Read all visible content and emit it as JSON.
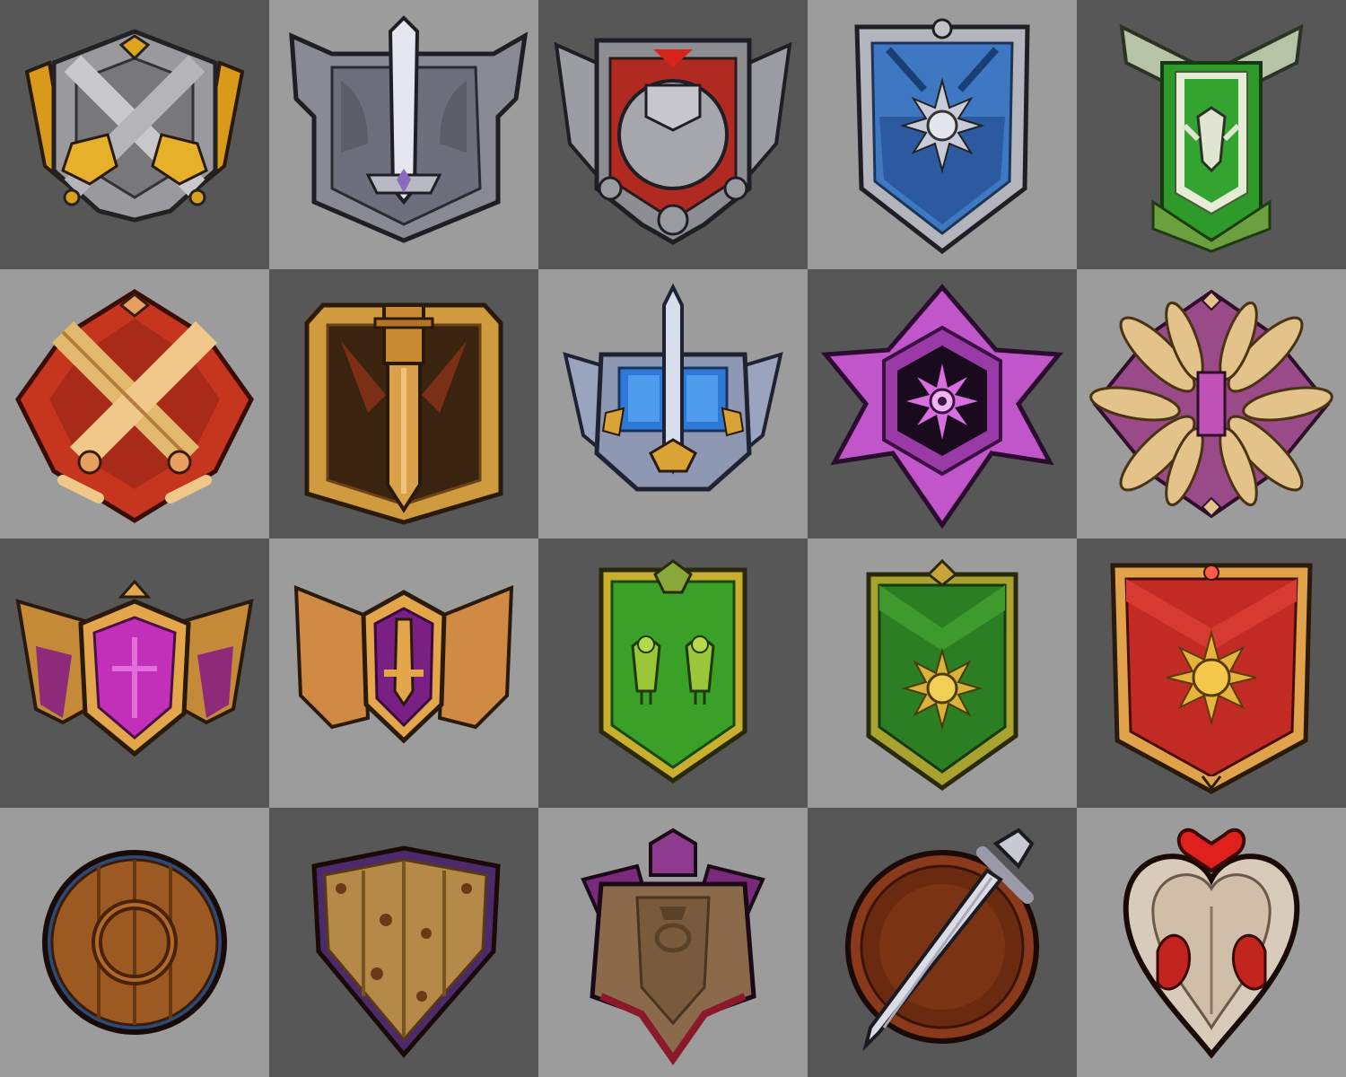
{
  "sheet": {
    "colors": {
      "dark_cell": "#575757",
      "light_cell": "#9c9c9c"
    },
    "emblems": [
      {
        "name": "crossed-swords-iron-crest-icon",
        "style": "steel-gold"
      },
      {
        "name": "steel-sword-crest-icon",
        "style": "steel"
      },
      {
        "name": "winged-steel-knight-crest-icon",
        "style": "steel-red"
      },
      {
        "name": "blue-sun-shield-icon",
        "style": "blue-steel"
      },
      {
        "name": "winged-green-banner-icon",
        "style": "green-silver"
      },
      {
        "name": "red-crossed-swords-badge-icon",
        "style": "red-gold"
      },
      {
        "name": "bronze-sword-plaque-icon",
        "style": "bronze"
      },
      {
        "name": "blue-crown-crest-icon",
        "style": "blue-steel"
      },
      {
        "name": "purple-eye-star-badge-icon",
        "style": "purple"
      },
      {
        "name": "golden-leaf-flower-crest-icon",
        "style": "gold-purple"
      },
      {
        "name": "winged-purple-shield-icon",
        "style": "gold-magenta"
      },
      {
        "name": "winged-purple-dagger-shield-icon",
        "style": "gold-magenta"
      },
      {
        "name": "green-birds-banner-icon",
        "style": "green-gold"
      },
      {
        "name": "green-sun-banner-icon",
        "style": "green-gold"
      },
      {
        "name": "red-sun-banner-icon",
        "style": "red-gold"
      },
      {
        "name": "round-wooden-shield-icon",
        "style": "wood-blue"
      },
      {
        "name": "wooden-heater-shield-icon",
        "style": "wood-purple"
      },
      {
        "name": "dark-bat-wing-shield-icon",
        "style": "brown-purple"
      },
      {
        "name": "round-shield-sword-icon",
        "style": "wood-silver"
      },
      {
        "name": "heart-armor-shield-icon",
        "style": "bone-red"
      }
    ]
  }
}
